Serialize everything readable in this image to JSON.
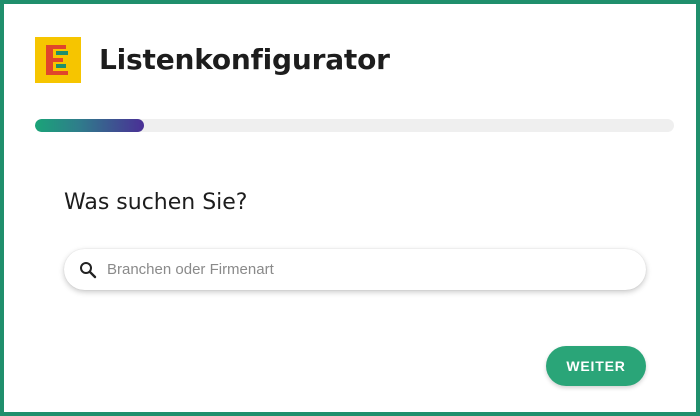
{
  "app": {
    "title": "Listenkonfigurator",
    "logo_icon": "listenkonfigurator-logo-icon"
  },
  "progress": {
    "percent": 17
  },
  "form": {
    "question": "Was suchen Sie?",
    "search": {
      "icon": "search-icon",
      "value": "",
      "placeholder": "Branchen oder Firmenart"
    },
    "next_label": "WEITER"
  },
  "colors": {
    "frame": "#1f8f6c",
    "accent": "#2aa578",
    "progress_start": "#1aa478",
    "progress_end": "#4a2f96",
    "logo_background": "#f6c500",
    "logo_mark": "#e0452b"
  }
}
